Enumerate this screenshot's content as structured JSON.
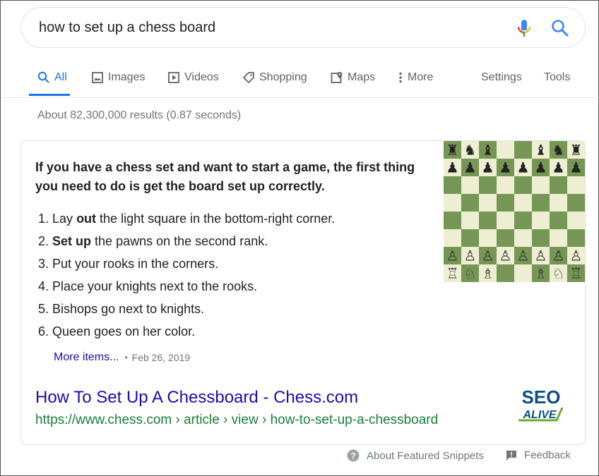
{
  "search": {
    "query": "how to set up a chess board"
  },
  "tabs": [
    {
      "label": "All",
      "icon": "search-icon",
      "active": true
    },
    {
      "label": "Images",
      "icon": "image-icon"
    },
    {
      "label": "Videos",
      "icon": "play-icon"
    },
    {
      "label": "Shopping",
      "icon": "tag-icon"
    },
    {
      "label": "Maps",
      "icon": "map-icon"
    },
    {
      "label": "More",
      "icon": "kebab-icon"
    }
  ],
  "tools": {
    "settings": "Settings",
    "tools": "Tools"
  },
  "result_stats": "About 82,300,000 results (0.87 seconds)",
  "snippet": {
    "lead": "If you have a chess set and want to start a game, the first thing you need to do is get the board set up correctly.",
    "steps": [
      {
        "num": "1.",
        "pre": "Lay ",
        "bold": "out",
        "post": " the light square in the bottom-right corner."
      },
      {
        "num": "2.",
        "pre": "",
        "bold": "Set up",
        "post": " the pawns on the second rank."
      },
      {
        "num": "3.",
        "pre": "Put your rooks in the corners.",
        "bold": "",
        "post": ""
      },
      {
        "num": "4.",
        "pre": "Place your knights next to the rooks.",
        "bold": "",
        "post": ""
      },
      {
        "num": "5.",
        "pre": "Bishops go next to knights.",
        "bold": "",
        "post": ""
      },
      {
        "num": "6.",
        "pre": "Queen goes on her color.",
        "bold": "",
        "post": ""
      }
    ],
    "more_items": "More items...",
    "separator": "•",
    "date": "Feb 26, 2019",
    "title": "How To Set Up A Chessboard - Chess.com",
    "url": "https://www.chess.com › article › view › how-to-set-up-a-chessboard",
    "logo": {
      "line1": "SEO",
      "line2": "ALIVE"
    }
  },
  "footer": {
    "about": "About Featured Snippets",
    "feedback": "Feedback"
  },
  "colors": {
    "accent": "#1a73e8",
    "link": "#1a0dab",
    "url_green": "#188038",
    "board_dark": "#769656",
    "board_light": "#eeeed2",
    "seo_blue": "#0f4c81",
    "seo_green": "#6cab2c"
  }
}
